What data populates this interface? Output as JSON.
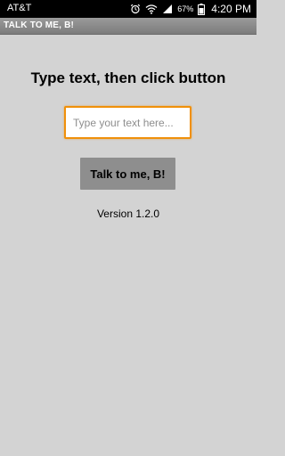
{
  "status_bar": {
    "carrier": "AT&T",
    "battery_percent": "67%",
    "time": "4:20 PM",
    "icons": [
      "alarm-icon",
      "wifi-icon",
      "signal-icon",
      "battery-icon"
    ]
  },
  "app_bar": {
    "title": "TALK TO ME, B!",
    "background_color": "#888888"
  },
  "main": {
    "instructions": "Type text, then click button",
    "input": {
      "value": "",
      "placeholder": "Type your text here...",
      "focus_color": "#f0900a"
    },
    "button_label": "Talk to me, B!",
    "version": "Version 1.2.0"
  }
}
